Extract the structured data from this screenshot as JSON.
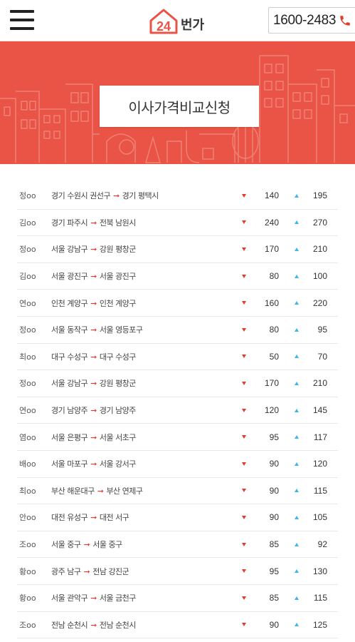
{
  "header": {
    "logo_number": "24",
    "logo_text": "번가",
    "phone": "1600-2483",
    "brand_color": "#e95446"
  },
  "banner": {
    "title": "이사가격비교신청"
  },
  "quotes": [
    {
      "name": "정oo",
      "from": "경기 수원시 권선구",
      "to": "경기 평택시",
      "min": "140",
      "max": "195"
    },
    {
      "name": "김oo",
      "from": "경기 파주시",
      "to": "전북 남원시",
      "min": "240",
      "max": "270"
    },
    {
      "name": "정oo",
      "from": "서울 강남구",
      "to": "강원 평창군",
      "min": "170",
      "max": "210"
    },
    {
      "name": "김oo",
      "from": "서울 광진구",
      "to": "서울 광진구",
      "min": "80",
      "max": "100"
    },
    {
      "name": "연oo",
      "from": "인천 계양구",
      "to": "인천 계양구",
      "min": "160",
      "max": "220"
    },
    {
      "name": "정oo",
      "from": "서울 동작구",
      "to": "서울 영등포구",
      "min": "80",
      "max": "95"
    },
    {
      "name": "최oo",
      "from": "대구 수성구",
      "to": "대구 수성구",
      "min": "50",
      "max": "70"
    },
    {
      "name": "정oo",
      "from": "서울 강남구",
      "to": "강원 평창군",
      "min": "170",
      "max": "210"
    },
    {
      "name": "연oo",
      "from": "경기 남양주",
      "to": "경기 남양주",
      "min": "120",
      "max": "145"
    },
    {
      "name": "염oo",
      "from": "서울 은평구",
      "to": "서울 서초구",
      "min": "95",
      "max": "117"
    },
    {
      "name": "배oo",
      "from": "서울 마포구",
      "to": "서울 강서구",
      "min": "90",
      "max": "120"
    },
    {
      "name": "최oo",
      "from": "부산 해운대구",
      "to": "부산 연제구",
      "min": "90",
      "max": "115"
    },
    {
      "name": "안oo",
      "from": "대전 유성구",
      "to": "대전 서구",
      "min": "90",
      "max": "105"
    },
    {
      "name": "조oo",
      "from": "서울 중구",
      "to": "서울 중구",
      "min": "85",
      "max": "92"
    },
    {
      "name": "황oo",
      "from": "광주 남구",
      "to": "전남 강진군",
      "min": "95",
      "max": "130"
    },
    {
      "name": "황oo",
      "from": "서울 관악구",
      "to": "서울 금천구",
      "min": "85",
      "max": "115"
    },
    {
      "name": "조oo",
      "from": "전남 순천시",
      "to": "전남 순천시",
      "min": "90",
      "max": "125"
    }
  ],
  "route_arrow": "➞",
  "icons": {
    "menu": "hamburger-icon",
    "phone": "phone-icon",
    "min": "triangle-down-icon",
    "max": "triangle-up-icon"
  }
}
